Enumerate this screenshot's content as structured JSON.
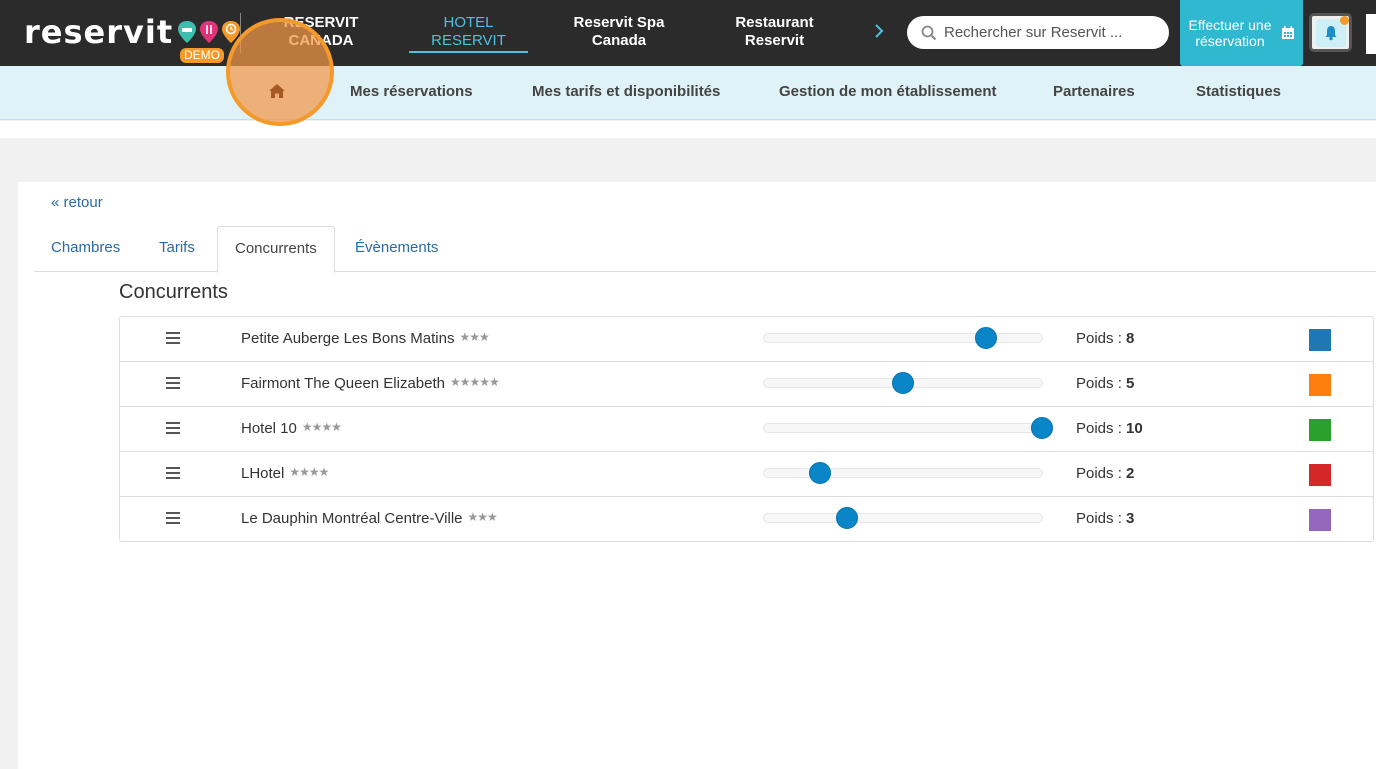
{
  "app": {
    "logo_text": "reservit",
    "logo_pins": [
      {
        "icon": "bed-pin-icon",
        "color": "#3dbfb0"
      },
      {
        "icon": "fork-knife-pin-icon",
        "color": "#e0337a"
      },
      {
        "icon": "clock-pin-icon",
        "color": "#f39a2b"
      }
    ],
    "demo_badge": "DEMO"
  },
  "topnav": {
    "tabs": [
      {
        "label": "RESERVIT CANADA",
        "active": false
      },
      {
        "label": "HOTEL RESERVIT",
        "active": true
      },
      {
        "label": "Reservit Spa Canada",
        "active": false
      },
      {
        "label": "Restaurant Reservit",
        "active": false
      }
    ],
    "next_icon": "chevron-right-icon",
    "search_placeholder": "Rechercher sur Reservit ...",
    "cta_label": "Effectuer une réservation",
    "cta_icon": "calendar-icon",
    "notification_icon": "bell-icon"
  },
  "subnav": {
    "home_icon": "home-icon",
    "items": [
      "Mes réservations",
      "Mes tarifs et disponibilités",
      "Gestion de mon établissement",
      "Partenaires",
      "Statistiques"
    ]
  },
  "page": {
    "back_label": "« retour",
    "tabs": [
      {
        "label": "Chambres",
        "active": false
      },
      {
        "label": "Tarifs",
        "active": false
      },
      {
        "label": "Concurrents",
        "active": true
      },
      {
        "label": "Évènements",
        "active": false
      }
    ],
    "section_title": "Concurrents",
    "weight_label": "Poids :",
    "slider_max": 10,
    "competitors": [
      {
        "name": "Petite Auberge Les Bons Matins",
        "stars": "★★★",
        "weight": "8",
        "weight_value": 8,
        "color": "#1f77b4"
      },
      {
        "name": "Fairmont The Queen Elizabeth",
        "stars": "★★★★★",
        "weight": "5",
        "weight_value": 5,
        "color": "#ff7f0e"
      },
      {
        "name": "Hotel 10",
        "stars": "★★★★",
        "weight": "10",
        "weight_value": 10,
        "color": "#2ca02c"
      },
      {
        "name": "LHotel",
        "stars": "★★★★",
        "weight": "2",
        "weight_value": 2,
        "color": "#d62728"
      },
      {
        "name": "Le Dauphin Montréal Centre-Ville",
        "stars": "★★★",
        "weight": "3",
        "weight_value": 3,
        "color": "#9467bd"
      }
    ]
  },
  "colors": {
    "topbar_bg": "#2b2b2b",
    "accent": "#2fb8d0",
    "active_tab": "#4fc1e0",
    "subnav_bg": "#dff2f7",
    "link": "#2a6aa6",
    "slider_thumb": "#0a85c7",
    "highlight": "#f39a2b"
  }
}
